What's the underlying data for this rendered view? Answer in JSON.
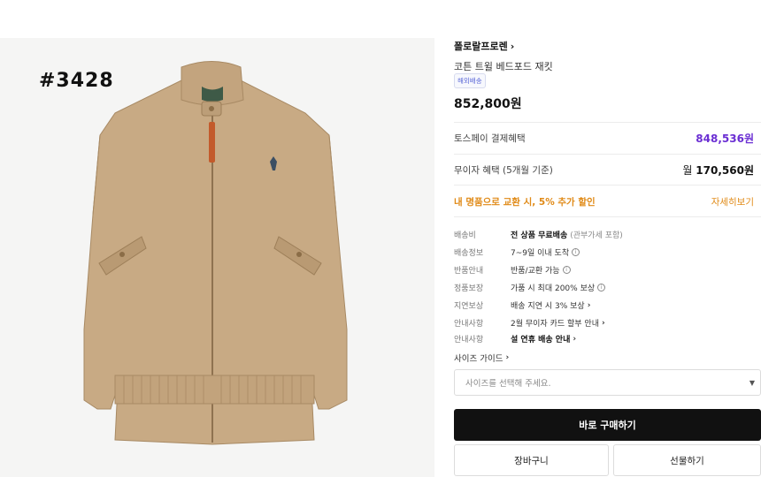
{
  "product_code": "#3428",
  "brand": {
    "name": "폴로랄프로렌",
    "chevron": "›"
  },
  "product": {
    "name": "코튼 트윌 베드포드 재킷",
    "badge": "해외배송",
    "price": "852,800원"
  },
  "payment": {
    "toss_label": "토스페이 결제혜택",
    "toss_price": "848,536원",
    "interest_label": "무이자 혜택 (5개월 기준)",
    "monthly_prefix": "월",
    "monthly_amount": "170,560원"
  },
  "promo": {
    "text": "내 명품으로 교환 시, 5% 추가 할인",
    "link": "자세히보기"
  },
  "specs": [
    {
      "label": "배송비",
      "value_bold": "전 상품 무료배송",
      "value_muted": "(관부가세 포함)"
    },
    {
      "label": "배송정보",
      "value": "7~9일 이내 도착",
      "icon": "info-icon"
    },
    {
      "label": "반품안내",
      "value": "반품/교환 가능",
      "icon": "info-icon"
    },
    {
      "label": "정품보장",
      "value": "가품 시 최대 200% 보상",
      "icon": "info-icon"
    },
    {
      "label": "지연보상",
      "value": "배송 지연 시 3% 보상",
      "icon": "chevron-right-icon"
    },
    {
      "label": "안내사항",
      "value": "2월 무이자 카드 할부 안내",
      "icon": "chevron-right-icon"
    },
    {
      "label": "안내사항",
      "value_bold": "설 연휴 배송 안내",
      "icon": "chevron-right-icon"
    }
  ],
  "size_guide": "사이즈 가이드",
  "size_select": {
    "placeholder": "사이즈를 선택해 주세요."
  },
  "buttons": {
    "buy": "바로 구매하기",
    "cart": "장바구니",
    "gift": "선물하기"
  },
  "colors": {
    "toss": "#6b2fd3",
    "promo": "#e08a17",
    "badge": "#5b68d8",
    "primary_btn": "#111111"
  }
}
